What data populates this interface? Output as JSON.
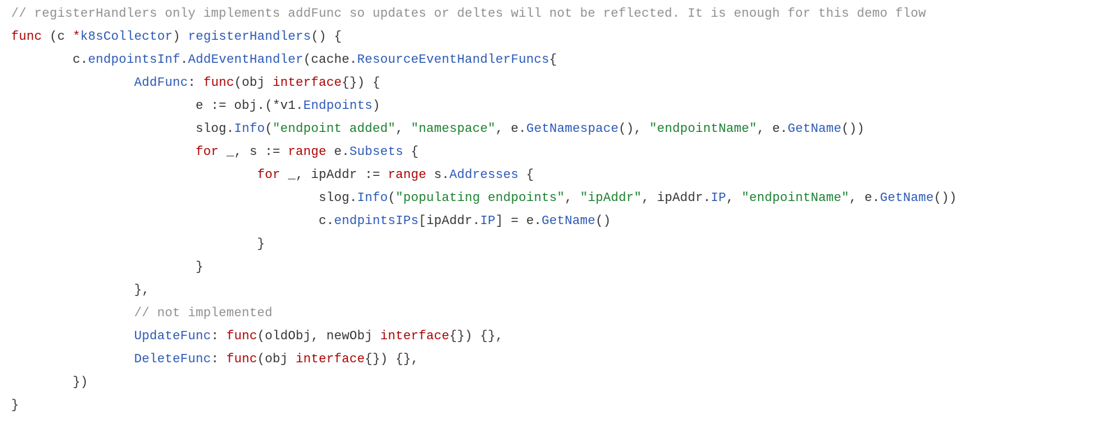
{
  "code": {
    "c1": "// registerHandlers only implements addFunc so updates or deltes will not be reflected. It is enough for this demo flow",
    "kw_func1": "func",
    "receiver_open": " (c ",
    "star": "*",
    "receiver_type": "k8sCollector",
    "receiver_close": ") ",
    "fn_name": "registerHandlers",
    "fn_sig_tail": "() {",
    "l3_a": "        c.",
    "l3_b": "endpointsInf",
    "l3_c": ".",
    "l3_d": "AddEventHandler",
    "l3_e": "(cache.",
    "l3_f": "ResourceEventHandlerFuncs",
    "l3_g": "{",
    "l4_indent": "                ",
    "l4_field": "AddFunc",
    "l4_colon": ": ",
    "l4_func": "func",
    "l4_args_open": "(obj ",
    "l4_iface": "interface",
    "l4_args_close": "{}) {",
    "l5_indent": "                        ",
    "l5_a": "e := obj.(*v1.",
    "l5_b": "Endpoints",
    "l5_c": ")",
    "l6_indent": "                        ",
    "l6_a": "slog.",
    "l6_b": "Info",
    "l6_c": "(",
    "l6_s1": "\"endpoint added\"",
    "l6_d": ", ",
    "l6_s2": "\"namespace\"",
    "l6_e": ", e.",
    "l6_f": "GetNamespace",
    "l6_g": "(), ",
    "l6_s3": "\"endpointName\"",
    "l6_h": ", e.",
    "l6_i": "GetName",
    "l6_j": "())",
    "l7_indent": "                        ",
    "l7_for": "for",
    "l7_a": " _, s := ",
    "l7_range": "range",
    "l7_b": " e.",
    "l7_c": "Subsets",
    "l7_d": " {",
    "l8_indent": "                                ",
    "l8_for": "for",
    "l8_a": " _, ipAddr := ",
    "l8_range": "range",
    "l8_b": " s.",
    "l8_c": "Addresses",
    "l8_d": " {",
    "l9_indent": "                                        ",
    "l9_a": "slog.",
    "l9_b": "Info",
    "l9_c": "(",
    "l9_s1": "\"populating endpoints\"",
    "l9_d": ", ",
    "l9_s2": "\"ipAddr\"",
    "l9_e": ", ipAddr.",
    "l9_f": "IP",
    "l9_g": ", ",
    "l9_s3": "\"endpointName\"",
    "l9_h": ", e.",
    "l9_i": "GetName",
    "l9_j": "())",
    "l10_indent": "                                        ",
    "l10_a": "c.",
    "l10_b": "endpintsIPs",
    "l10_c": "[ipAddr.",
    "l10_d": "IP",
    "l10_e": "] = e.",
    "l10_f": "GetName",
    "l10_g": "()",
    "l11": "                                }",
    "l12": "                        }",
    "l13": "                },",
    "l14_indent": "                ",
    "l14_c": "// not implemented",
    "l15_indent": "                ",
    "l15_field": "UpdateFunc",
    "l15_colon": ": ",
    "l15_func": "func",
    "l15_args_open": "(oldObj, newObj ",
    "l15_iface": "interface",
    "l15_args_close": "{}) {},",
    "l16_indent": "                ",
    "l16_field": "DeleteFunc",
    "l16_colon": ": ",
    "l16_func": "func",
    "l16_args_open": "(obj ",
    "l16_iface": "interface",
    "l16_args_close": "{}) {},",
    "l17": "        })",
    "l18": "}"
  }
}
